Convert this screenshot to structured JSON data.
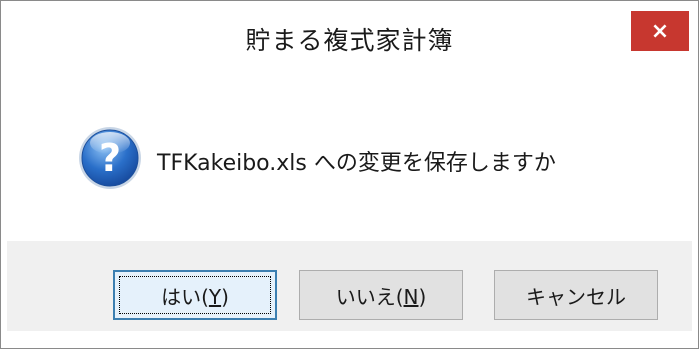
{
  "dialog": {
    "title": "貯まる複式家計簿",
    "close_label": "×",
    "message": "TFKakeibo.xls への変更を保存しますか",
    "icon": "question-icon",
    "buttons": {
      "yes": {
        "prefix": "はい(",
        "mnemonic": "Y",
        "suffix": ")"
      },
      "no": {
        "prefix": "いいえ(",
        "mnemonic": "N",
        "suffix": ")"
      },
      "cancel": {
        "label": "キャンセル"
      }
    },
    "colors": {
      "close_button": "#c7372f",
      "icon_blue": "#2a6fc9",
      "footer_bg": "#f0f0f0",
      "default_button_border": "#3c7fb1"
    }
  }
}
